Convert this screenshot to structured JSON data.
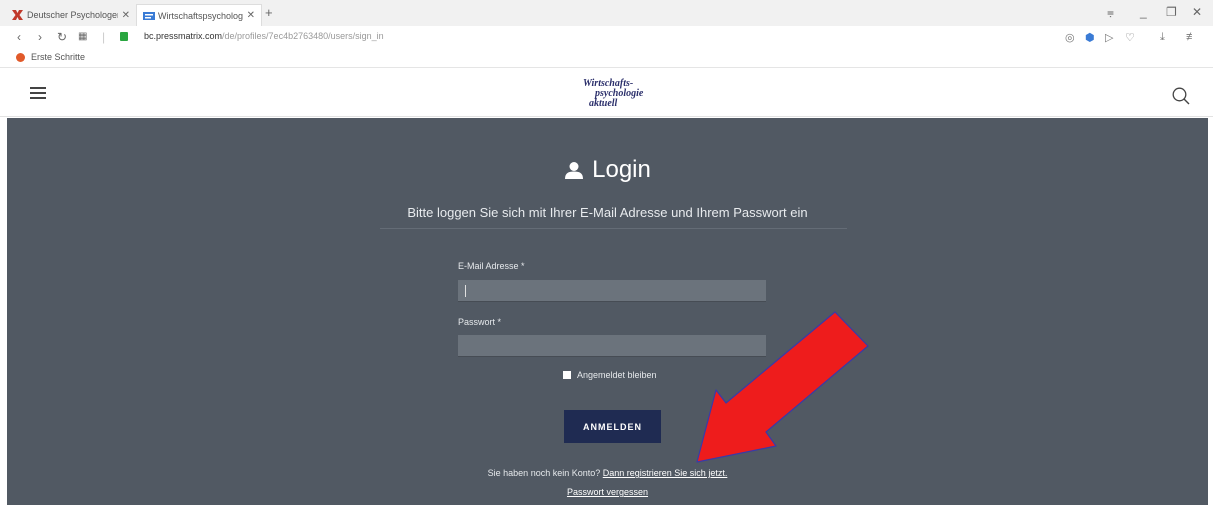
{
  "browser": {
    "tabs": [
      {
        "label": "Deutscher Psychologen-Ve",
        "icon": "x-logo-icon",
        "color": "#c0392b"
      },
      {
        "label": "Wirtschaftspsychologie akt",
        "icon": "site-favicon",
        "color": "#3a7bd5"
      }
    ],
    "url_domain": "bc.pressmatrix.com",
    "url_path": "/de/profiles/7ec4b2763480/users/sign_in",
    "bookmark": "Erste Schritte"
  },
  "site": {
    "logo_line1": "Wirtschafts-",
    "logo_line2": "psychologie",
    "logo_line3": "aktuell"
  },
  "login": {
    "title": "Login",
    "subtitle": "Bitte loggen Sie sich mit Ihrer E-Mail Adresse und Ihrem Passwort ein",
    "email_label": "E-Mail Adresse *",
    "email_value": "",
    "password_label": "Passwort *",
    "password_value": "",
    "remember_label": "Angemeldet bleiben",
    "submit_label": "ANMELDEN",
    "register_prefix": "Sie haben noch kein Konto?",
    "register_link": "Dann registrieren Sie sich jetzt.",
    "forgot_link": "Passwort vergessen"
  },
  "colors": {
    "panel_bg": "#515963",
    "button_bg": "#1f2b52",
    "annotation_arrow": "#ee1c1c"
  }
}
